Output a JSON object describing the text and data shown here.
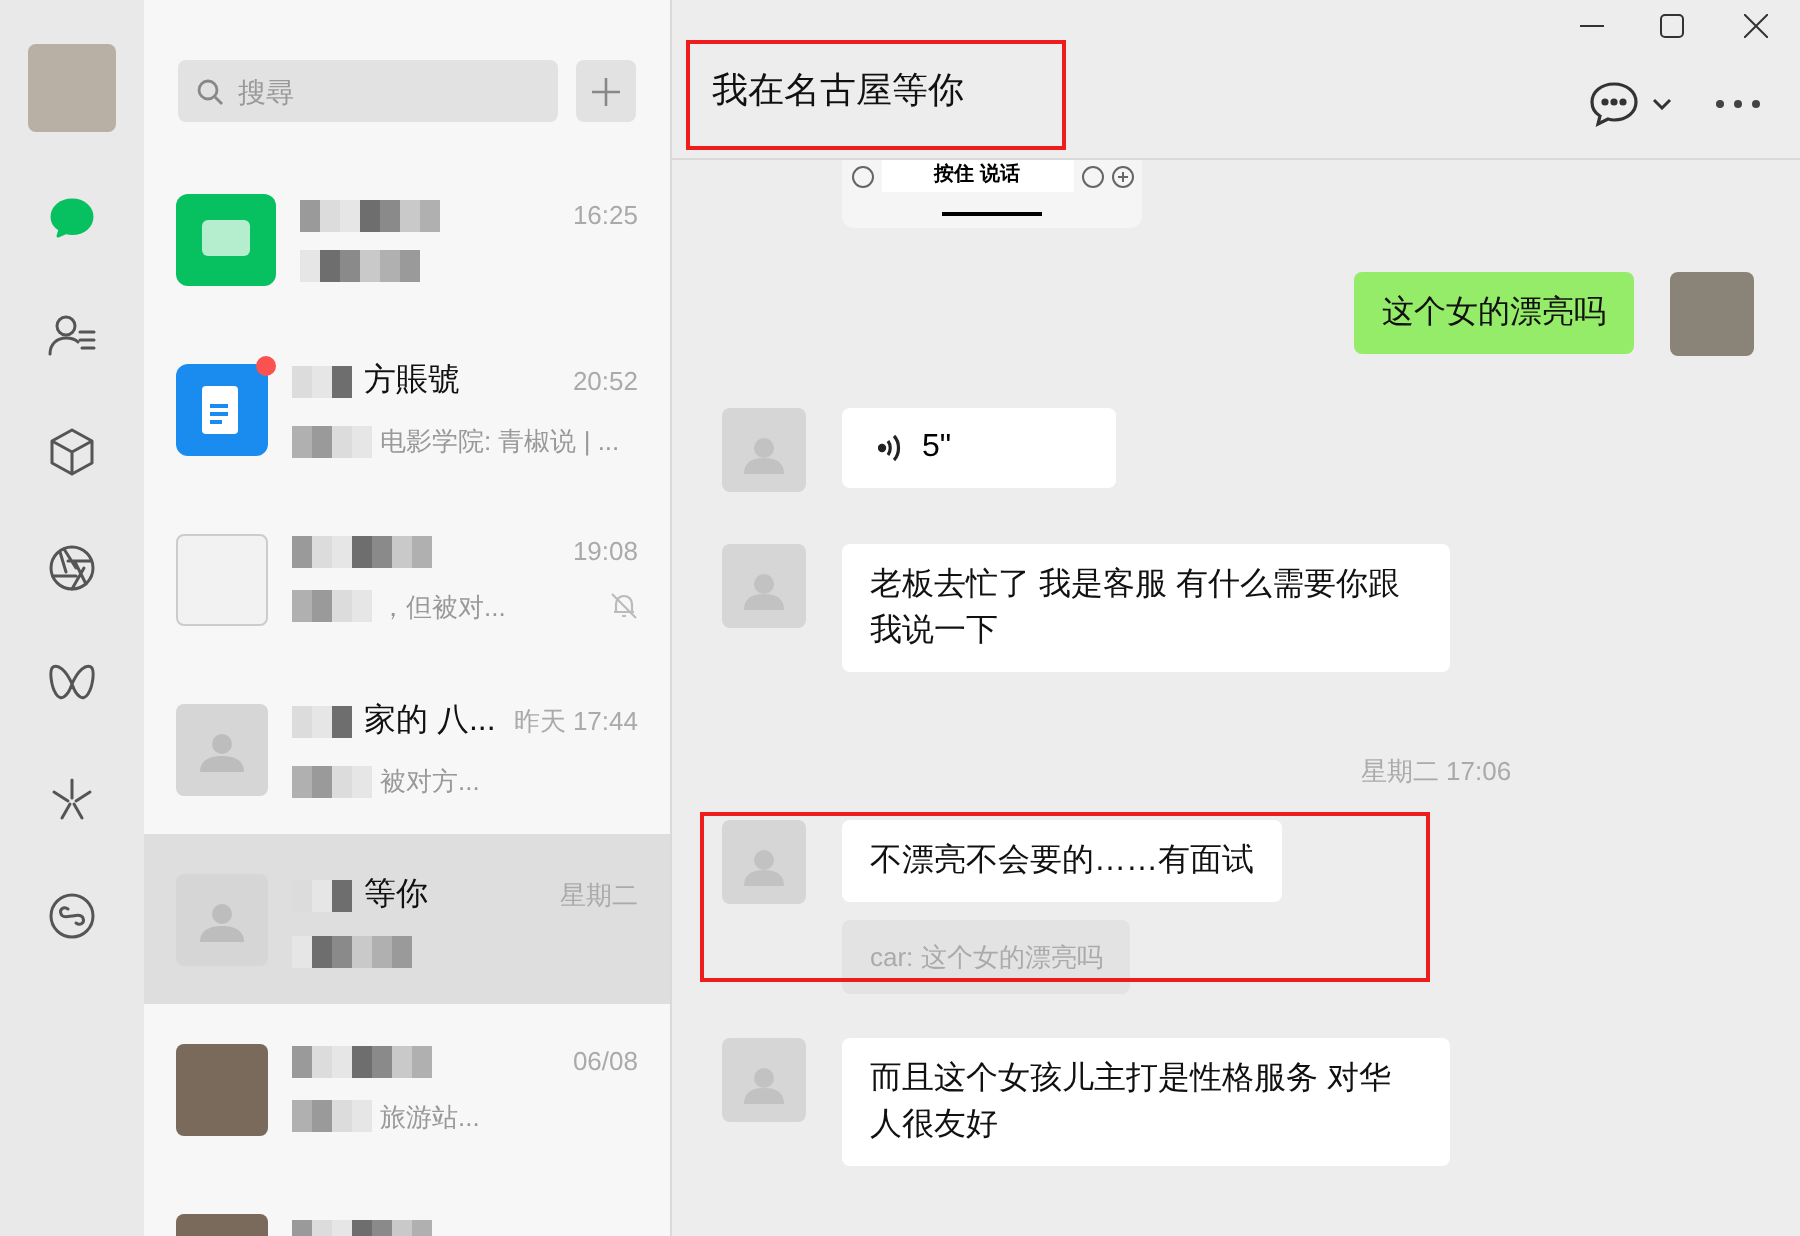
{
  "window": {
    "title": "我在名古屋等你"
  },
  "search": {
    "placeholder": "搜尋"
  },
  "nav_items": [
    {
      "kind": "chat",
      "selected": true
    },
    {
      "kind": "contacts",
      "selected": false
    },
    {
      "kind": "cube",
      "selected": false
    },
    {
      "kind": "aperture",
      "selected": false
    },
    {
      "kind": "butterfly",
      "selected": false
    },
    {
      "kind": "sparkle",
      "selected": false
    },
    {
      "kind": "link",
      "selected": false
    }
  ],
  "chats": [
    {
      "kind": "green-app",
      "time": "16:25",
      "unread": false,
      "muted": false,
      "selected": false
    },
    {
      "kind": "blue-app",
      "name": "方賬號",
      "time": "20:52",
      "preview": "电影学院: 青椒说 | ...",
      "unread": true,
      "muted": false,
      "selected": false
    },
    {
      "kind": "sketch",
      "time": "19:08",
      "preview": "，但被对...",
      "unread": false,
      "muted": true,
      "selected": false
    },
    {
      "kind": "default",
      "name": "家的 八...",
      "time": "昨天 17:44",
      "preview": "被对方...",
      "unread": false,
      "muted": false,
      "selected": false
    },
    {
      "kind": "default",
      "name": "等你",
      "time": "星期二",
      "unread": false,
      "muted": false,
      "selected": true
    },
    {
      "kind": "photo",
      "time": "06/08",
      "preview": "旅游站...",
      "unread": false,
      "muted": false,
      "selected": false
    },
    {
      "kind": "photo",
      "unread": false,
      "muted": false,
      "selected": false
    }
  ],
  "messages": [
    {
      "kind": "image",
      "from_me": false,
      "caption": "按住 说话"
    },
    {
      "kind": "text",
      "from_me": true,
      "text": "这个女的漂亮吗"
    },
    {
      "kind": "voice",
      "from_me": false,
      "duration": "5\""
    },
    {
      "kind": "text",
      "from_me": false,
      "text": "老板去忙了 我是客服 有什么需要你跟我说一下"
    },
    {
      "kind": "time",
      "text": "星期二 17:06"
    },
    {
      "kind": "text",
      "from_me": false,
      "text": "不漂亮不会要的……有面试"
    },
    {
      "kind": "quote",
      "text": "car: 这个女的漂亮吗"
    },
    {
      "kind": "text",
      "from_me": false,
      "text": "而且这个女孩儿主打是性格服务 对华人很友好"
    }
  ]
}
